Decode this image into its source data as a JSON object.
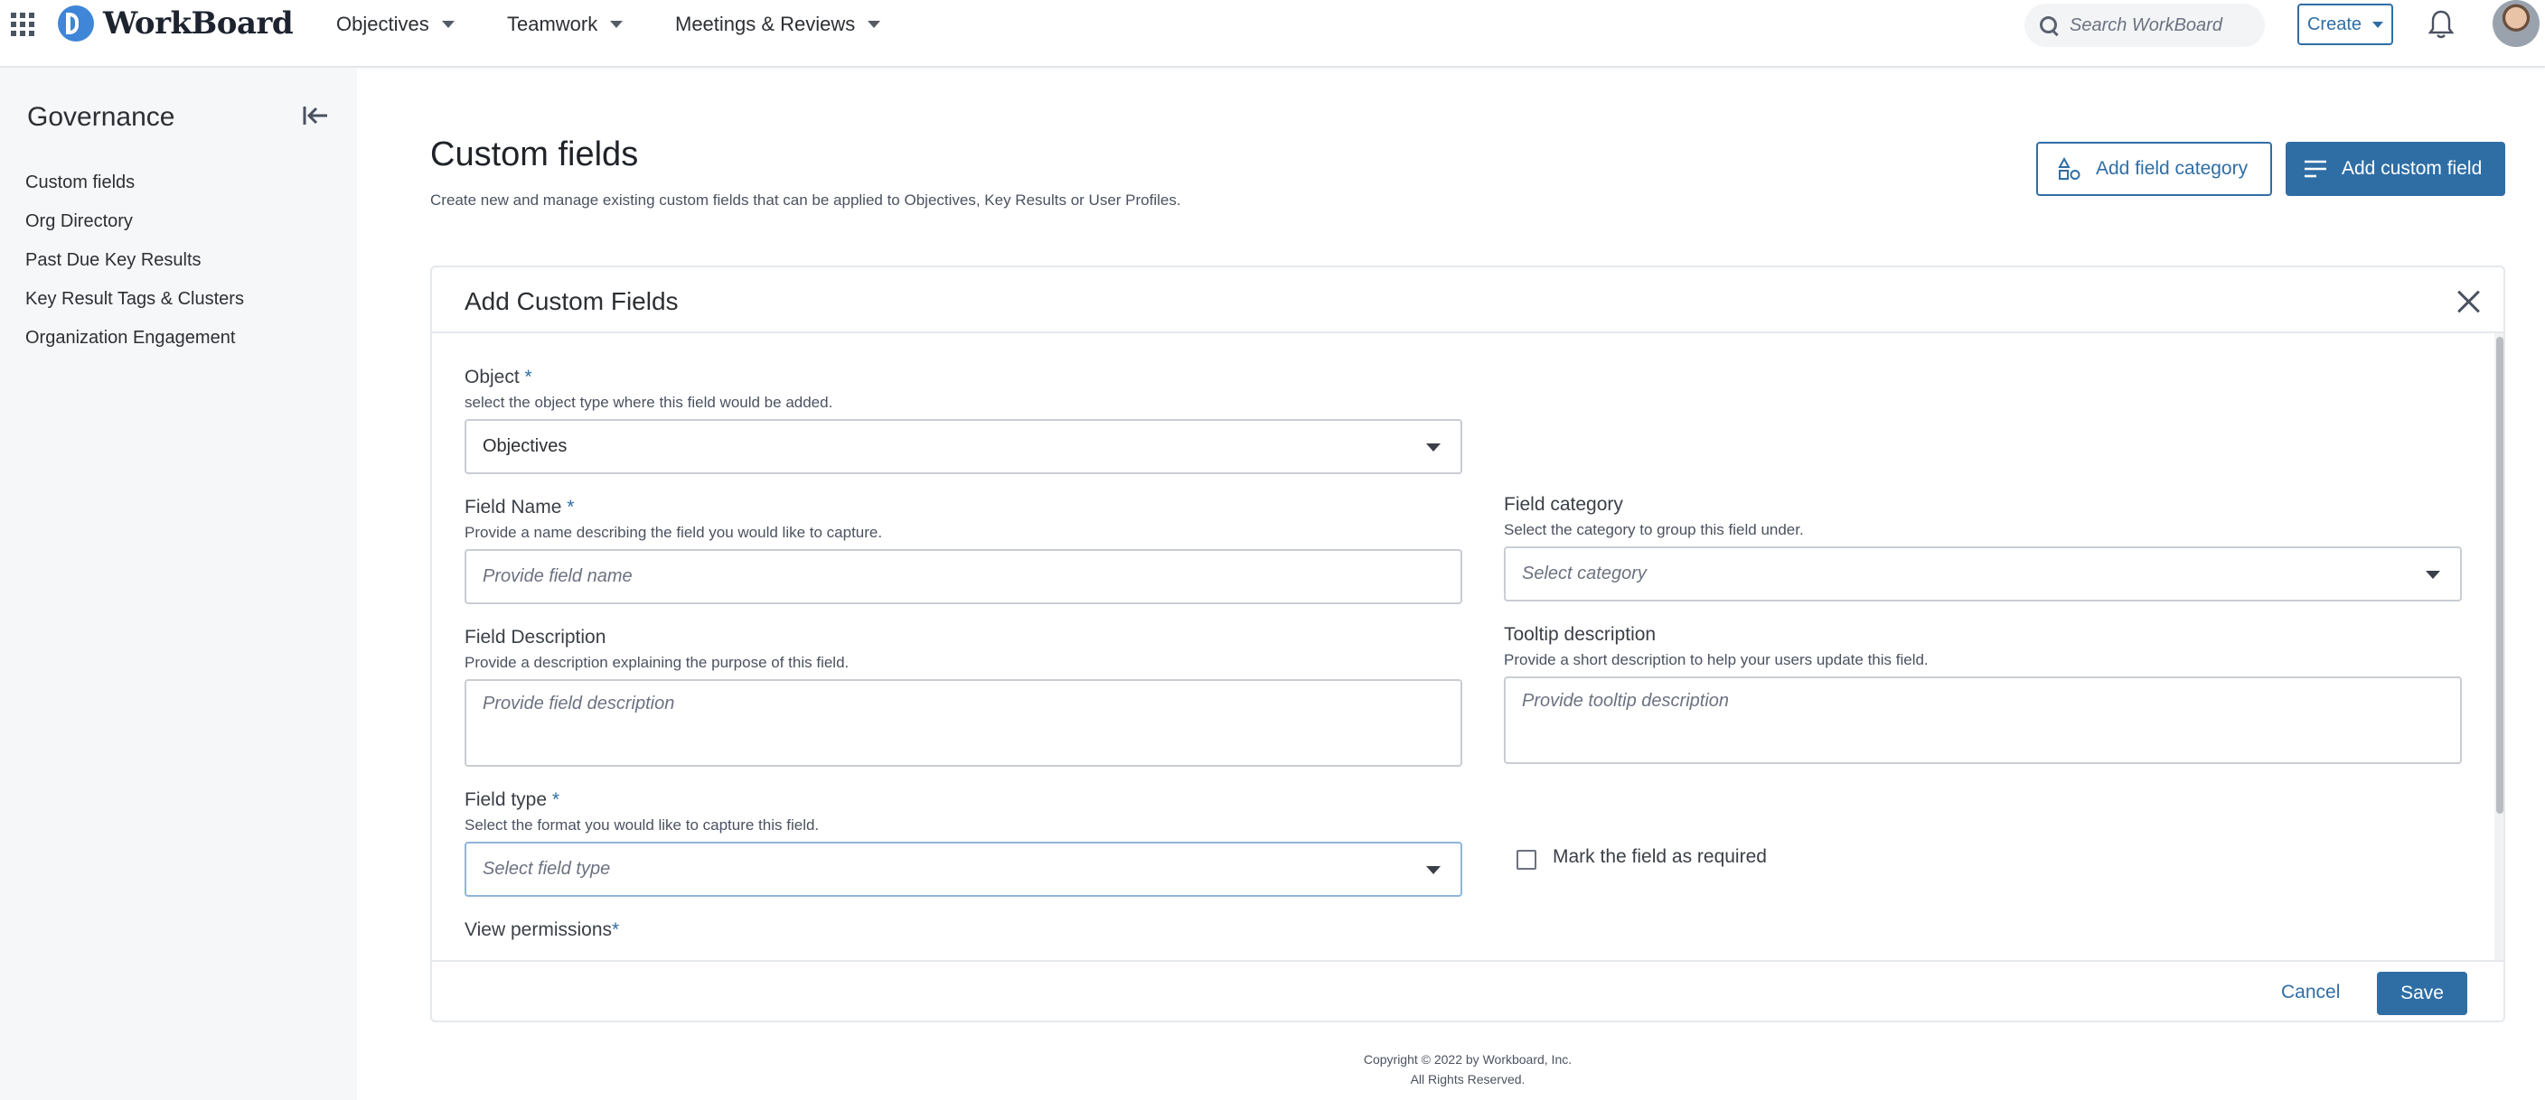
{
  "header": {
    "logo_text": "WorkBoard",
    "nav": [
      "Objectives",
      "Teamwork",
      "Meetings & Reviews"
    ],
    "search_placeholder": "Search WorkBoard",
    "create_label": "Create"
  },
  "sidebar": {
    "title": "Governance",
    "items": [
      "Custom fields",
      "Org Directory",
      "Past Due Key Results",
      "Key Result Tags & Clusters",
      "Organization Engagement"
    ]
  },
  "page": {
    "title": "Custom fields",
    "subtitle": "Create new and manage existing custom fields that can be applied to Objectives, Key Results or User Profiles.",
    "add_category_label": "Add field category",
    "add_field_label": "Add custom field"
  },
  "modal": {
    "title": "Add Custom Fields",
    "object": {
      "label": "Object",
      "required": "*",
      "hint": "select the object type where this field would be added.",
      "value": "Objectives"
    },
    "field_name": {
      "label": "Field Name",
      "required": "*",
      "hint": "Provide a name describing the field you would like to capture.",
      "placeholder": "Provide field name"
    },
    "field_category": {
      "label": "Field category",
      "hint": "Select the category to group this field under.",
      "placeholder": "Select category"
    },
    "field_description": {
      "label": "Field Description",
      "hint": "Provide a description explaining the purpose of this field.",
      "placeholder": "Provide field description"
    },
    "tooltip_description": {
      "label": "Tooltip description",
      "hint": "Provide a short description to help your users update this field.",
      "placeholder": "Provide tooltip description"
    },
    "field_type": {
      "label": "Field type",
      "required": "*",
      "hint": "Select the format you would like to capture this field.",
      "placeholder": "Select field type"
    },
    "required_checkbox": {
      "label": "Mark the field as required",
      "checked": false
    },
    "view_permissions": {
      "label": "View permissions",
      "required": "*"
    },
    "cancel_label": "Cancel",
    "save_label": "Save"
  },
  "footer": {
    "copyright": "Copyright © 2022 by Workboard, Inc.",
    "rights": "All Rights Reserved."
  }
}
